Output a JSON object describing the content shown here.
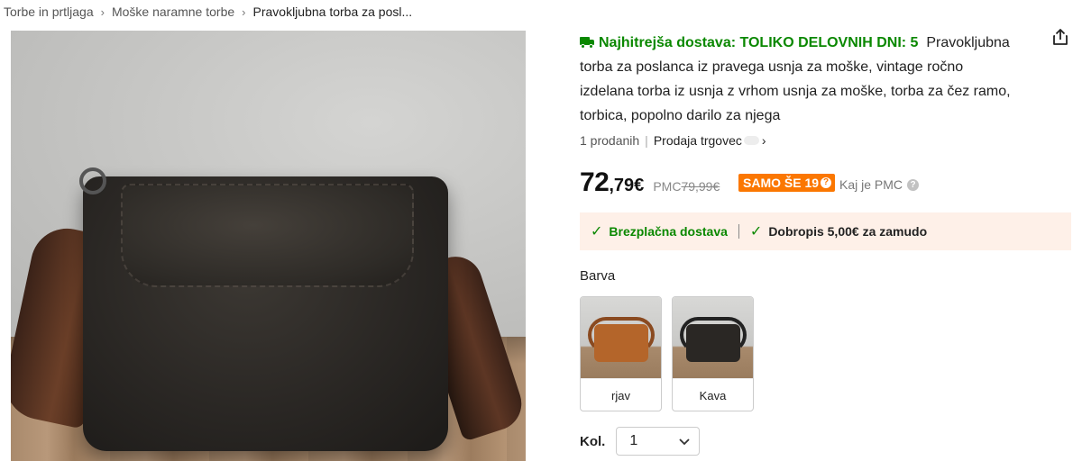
{
  "breadcrumb": {
    "items": [
      "Torbe in prtljaga",
      "Moške naramne torbe",
      "Pravokljubna torba za posl..."
    ],
    "separator": "›"
  },
  "product": {
    "fast_delivery_label": "Najhitrejša dostava: TOLIKO DELOVNIH DNI: 5",
    "title": "Pravokljubna torba za poslanca iz pravega usnja za moške, vintage ročno izdelana torba iz usnja z vrhom usnja za moške, torba za čez ramo, torbica, popolno darilo za njega",
    "sold_count": "1 prodanih",
    "seller_label": "Prodaja trgovec",
    "price_integer": "72",
    "price_decimal": ",79€",
    "pmc_label": "PMC",
    "pmc_value": "79,99€",
    "stock_badge": "SAMO ŠE 19",
    "pmc_help": "Kaj je PMC"
  },
  "promo": {
    "free_shipping": "Brezplačna dostava",
    "credit": "Dobropis 5,00€ za zamudo"
  },
  "colors": {
    "label": "Barva",
    "options": [
      {
        "label": "rjav",
        "swatch": "#b4652a"
      },
      {
        "label": "Kava",
        "swatch": "#2a2724"
      }
    ]
  },
  "quantity": {
    "label": "Kol.",
    "value": "1"
  },
  "icons": {
    "share": "share-icon",
    "truck": "truck-icon",
    "check": "check-icon",
    "chevron": "chevron-down-icon"
  },
  "colors_theme": {
    "green": "#0a8800",
    "orange": "#fb7701",
    "promo_bg": "#fef0e8"
  }
}
